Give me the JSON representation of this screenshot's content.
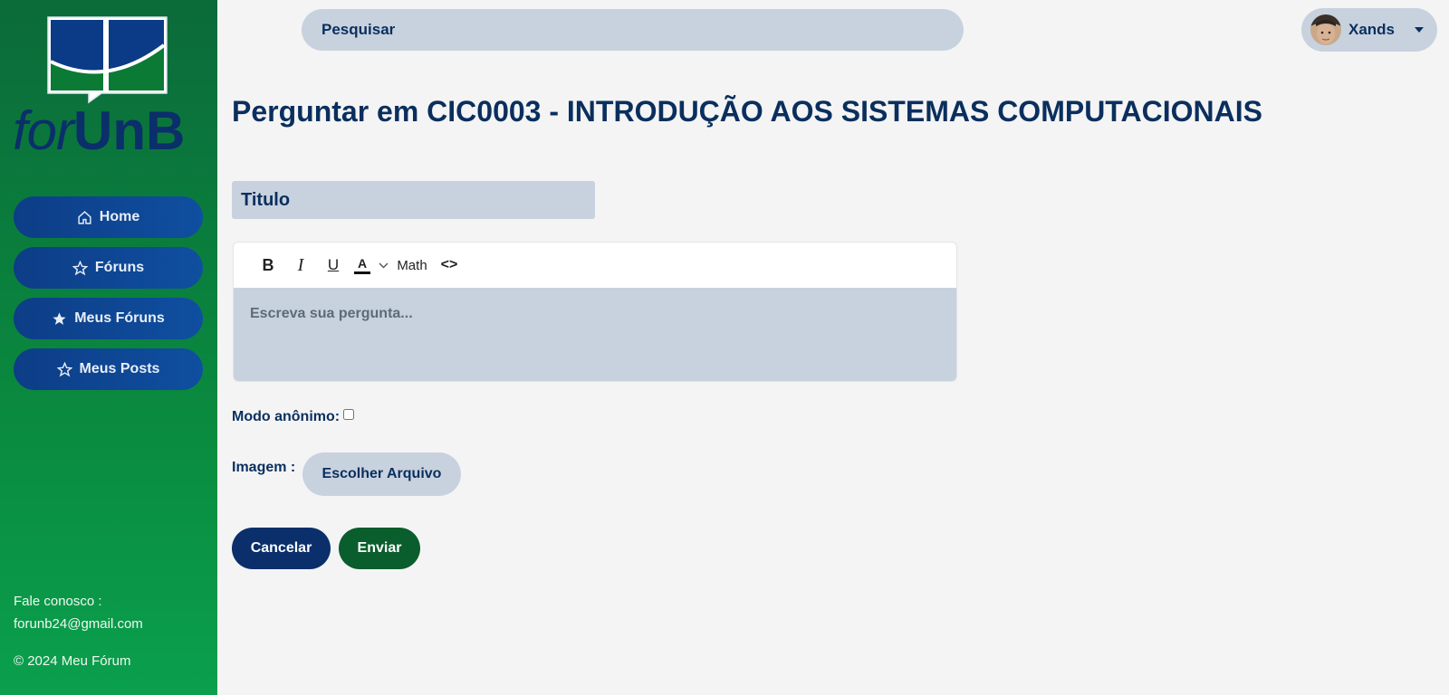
{
  "brand": {
    "for": "for",
    "unb": "UnB"
  },
  "nav": {
    "items": [
      {
        "label": "Home",
        "icon": "home-icon"
      },
      {
        "label": "Fóruns",
        "icon": "star-outline-icon"
      },
      {
        "label": "Meus Fóruns",
        "icon": "star-filled-icon"
      },
      {
        "label": "Meus Posts",
        "icon": "star-outline-icon"
      }
    ]
  },
  "footer": {
    "contact_label": "Fale conosco :",
    "email": "forunb24@gmail.com",
    "copyright": "© 2024 Meu Fórum"
  },
  "search": {
    "label": "Pesquisar"
  },
  "user": {
    "name": "Xands"
  },
  "page": {
    "title": "Perguntar em CIC0003 - INTRODUÇÃO AOS SISTEMAS COMPUTACIONAIS"
  },
  "form": {
    "title_placeholder": "Titulo",
    "toolbar": {
      "bold": "B",
      "italic": "I",
      "underline": "U",
      "color": "A",
      "math": "Math",
      "code": "<>"
    },
    "body_placeholder": "Escreva sua pergunta...",
    "anon_label": "Modo anônimo:",
    "image_label": "Imagem :",
    "file_button": "Escolher Arquivo",
    "cancel": "Cancelar",
    "submit": "Enviar"
  },
  "colors": {
    "primary_blue": "#0a2f6a",
    "accent_green": "#0a5d2c",
    "input_gray": "#c8d2de",
    "sidebar_green": "#0a8a3f"
  }
}
